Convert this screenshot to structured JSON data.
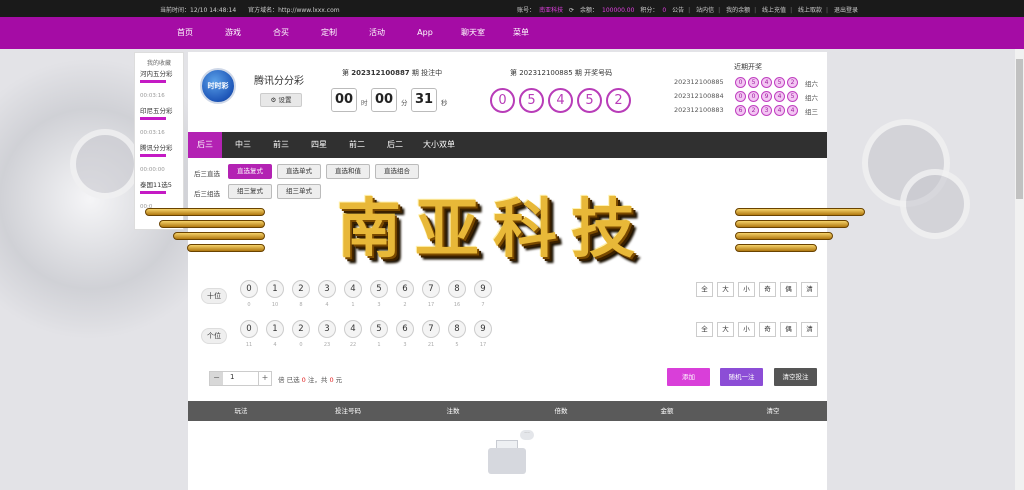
{
  "topbar": {
    "server_time": "当前时间：12/10 14:48:14",
    "official_site": "官方域名：http://www.lxxx.com",
    "account_label": "账号：",
    "account_value": "南亚科技",
    "balance_label": "余额：",
    "balance_value": "100000.00",
    "points_label": "积分：",
    "points_value": "0",
    "links": [
      "公告",
      "站内信",
      "我的余额",
      "线上充值",
      "线上取款",
      "退出登录"
    ]
  },
  "nav": {
    "items": [
      "首页",
      "游戏",
      "合买",
      "定制",
      "活动",
      "App",
      "聊天室",
      "菜单"
    ]
  },
  "favorites": {
    "title": "我的收藏",
    "items": [
      {
        "name": "河内五分彩",
        "time": "00:03:16"
      },
      {
        "name": "印尼五分彩",
        "time": "00:03:16"
      },
      {
        "name": "腾讯分分彩",
        "time": "00:00:00"
      },
      {
        "name": "泰国11选5",
        "time": "00:0"
      }
    ]
  },
  "lottery": {
    "name": "腾讯分分彩",
    "logo_text": "时时彩",
    "settings_label": "⚙ 设置",
    "current_prefix": "第",
    "current_issue": "202312100887",
    "current_suffix": "期  投注中",
    "timer": {
      "h": "00",
      "m": "00",
      "s": "31",
      "h_unit": "时",
      "m_unit": "分",
      "s_unit": "秒"
    },
    "prev_label": "第 202312100885 期  开奖号码",
    "prev_numbers": [
      "0",
      "5",
      "4",
      "5",
      "2"
    ],
    "recent_title": "近期开奖",
    "recent": [
      {
        "issue": "202312100885",
        "nums": [
          "0",
          "5",
          "4",
          "5",
          "2"
        ],
        "group": "组六"
      },
      {
        "issue": "202312100884",
        "nums": [
          "0",
          "0",
          "9",
          "4",
          "5"
        ],
        "group": "组六"
      },
      {
        "issue": "202312100883",
        "nums": [
          "6",
          "2",
          "3",
          "4",
          "4"
        ],
        "group": "组三"
      }
    ]
  },
  "tabs": [
    "后三",
    "中三",
    "前三",
    "四星",
    "前二",
    "后二",
    "大小双单"
  ],
  "subplay": {
    "row1_label": "后三直选",
    "row1": [
      "直选复式",
      "直选单式",
      "直选和值",
      "直选组合"
    ],
    "row2_label": "后三组选",
    "row2": [
      "组三复式",
      "组三单式"
    ]
  },
  "positions": [
    {
      "label": "十位",
      "digits": [
        "0",
        "1",
        "2",
        "3",
        "4",
        "5",
        "6",
        "7",
        "8",
        "9"
      ],
      "missing": [
        "0",
        "10",
        "8",
        "4",
        "1",
        "3",
        "2",
        "17",
        "16",
        "7"
      ]
    },
    {
      "label": "个位",
      "digits": [
        "0",
        "1",
        "2",
        "3",
        "4",
        "5",
        "6",
        "7",
        "8",
        "9"
      ],
      "missing": [
        "11",
        "4",
        "0",
        "23",
        "22",
        "1",
        "3",
        "21",
        "5",
        "17"
      ]
    }
  ],
  "quick": [
    "全",
    "大",
    "小",
    "奇",
    "偶",
    "清"
  ],
  "bet": {
    "multiplier": "1",
    "minus": "−",
    "plus": "+",
    "info_prefix": "倍  已选",
    "count": "0",
    "info_mid": "注，共",
    "amount": "0",
    "info_suffix": "元",
    "add_label": "添加",
    "random_label": "随机一注",
    "clear_label": "清空投注"
  },
  "table": {
    "headers": [
      "玩法",
      "投注号码",
      "注数",
      "倍数",
      "金额",
      "清空"
    ]
  },
  "watermark": {
    "text": "南亚科技"
  },
  "colors": {
    "brand": "#a50ca5",
    "accent": "#b322b3",
    "add_button": "#d93fd9",
    "random_button": "#8c4dd6",
    "clear_button": "#555555"
  }
}
